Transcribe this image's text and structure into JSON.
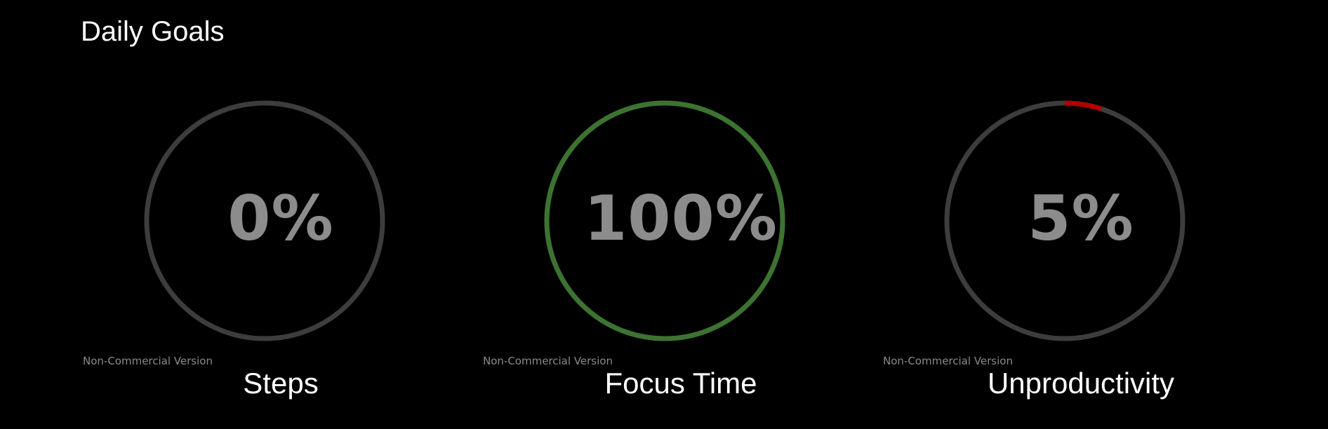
{
  "header": {
    "title": "Daily Goals"
  },
  "colors": {
    "background": "#000000",
    "track": "#3d3d3d",
    "value_text": "#8c8c8c",
    "label_text": "#ffffff"
  },
  "gauges": [
    {
      "label": "Steps",
      "value_text": "0%",
      "percent": 0,
      "progress_color": "#3d3d3d",
      "watermark": "Non-Commercial Version"
    },
    {
      "label": "Focus Time",
      "value_text": "100%",
      "percent": 100,
      "progress_color": "#3c7330",
      "watermark": "Non-Commercial Version"
    },
    {
      "label": "Unproductivity",
      "value_text": "5%",
      "percent": 5,
      "progress_color": "#b00000",
      "watermark": "Non-Commercial Version"
    }
  ]
}
